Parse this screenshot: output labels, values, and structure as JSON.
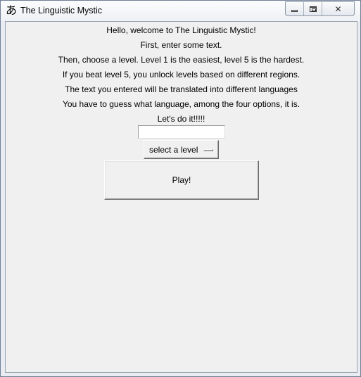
{
  "window": {
    "title": "The Linguistic Mystic",
    "icon_glyph": "あ",
    "icon_name": "hiragana-a-icon",
    "controls": {
      "minimize": "minimize-icon",
      "maximize": "maximize-icon",
      "close": "close-icon",
      "close_glyph": "✕"
    }
  },
  "instructions": [
    "Hello, welcome to The Linguistic Mystic!",
    "First, enter some text.",
    "Then, choose a level. Level 1 is the easiest, level 5 is the hardest.",
    "If you beat level 5, you unlock levels based on different regions.",
    "The text you entered will be translated into different languages",
    "You have to guess what language, among the four options, it is.",
    "Let's do it!!!!!"
  ],
  "text_input": {
    "value": "",
    "placeholder": ""
  },
  "level_menu": {
    "selected": "select a level"
  },
  "play_button": {
    "label": "Play!"
  },
  "colors": {
    "client_background": "#f0f0f0",
    "title_bar": "#fbfcfd",
    "window_frame": "#6e7f95"
  }
}
